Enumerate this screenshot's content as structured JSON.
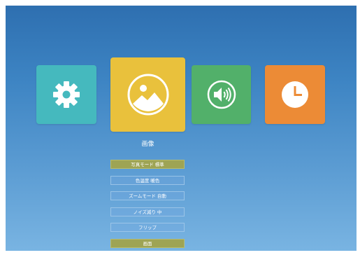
{
  "tiles": [
    {
      "name": "settings",
      "icon": "gear-icon",
      "color": "#45b9be"
    },
    {
      "name": "picture",
      "icon": "image-icon",
      "color": "#e9c13c",
      "selected": true
    },
    {
      "name": "sound",
      "icon": "speaker-icon",
      "color": "#52b06a"
    },
    {
      "name": "timer",
      "icon": "clock-icon",
      "color": "#ec8b36"
    }
  ],
  "section_label": "画像",
  "menu": {
    "items": [
      {
        "label": "写真モード 標準",
        "selected": true
      },
      {
        "label": "色温度 暖色",
        "selected": false
      },
      {
        "label": "ズームモード 自動",
        "selected": false
      },
      {
        "label": "ノイズ減り 中",
        "selected": false
      },
      {
        "label": "フリップ",
        "selected": false
      },
      {
        "label": "画面",
        "selected": true
      }
    ]
  },
  "colors": {
    "background_top": "#2e6fb0",
    "background_bottom": "#79b4e2",
    "selected_item": "#9ea454"
  }
}
